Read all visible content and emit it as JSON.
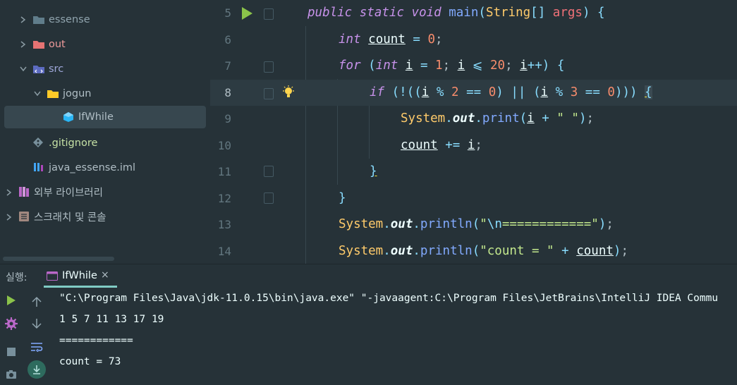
{
  "project_tree": {
    "items": [
      {
        "label": "essense",
        "icon": "folder-icon"
      },
      {
        "label": "out",
        "icon": "folder-excluded-icon"
      },
      {
        "label": "src",
        "icon": "source-folder-icon"
      },
      {
        "label": "jogun",
        "icon": "package-icon"
      },
      {
        "label": "IfWhile",
        "icon": "java-class-icon"
      },
      {
        "label": ".gitignore",
        "icon": "git-icon"
      },
      {
        "label": "java_essense.iml",
        "icon": "iml-file-icon"
      },
      {
        "label": "외부 라이브러리",
        "icon": "library-icon"
      },
      {
        "label": "스크래치 및 콘솔",
        "icon": "scratch-icon"
      }
    ]
  },
  "editor": {
    "line_numbers": [
      "5",
      "6",
      "7",
      "8",
      "9",
      "10",
      "11",
      "12",
      "13",
      "14"
    ],
    "current_line": "8"
  },
  "run_panel": {
    "label": "실행:",
    "tab_label": "IfWhile",
    "close_glyph": "×",
    "console_lines": [
      "\"C:\\Program Files\\Java\\jdk-11.0.15\\bin\\java.exe\" \"-javaagent:C:\\Program Files\\JetBrains\\IntelliJ IDEA Commu",
      "1 5 7 11 13 17 19",
      "============",
      "count = 73"
    ]
  },
  "colors": {
    "background": "#263238",
    "accent": "#80cbc4",
    "run_green": "#8bc34a"
  }
}
